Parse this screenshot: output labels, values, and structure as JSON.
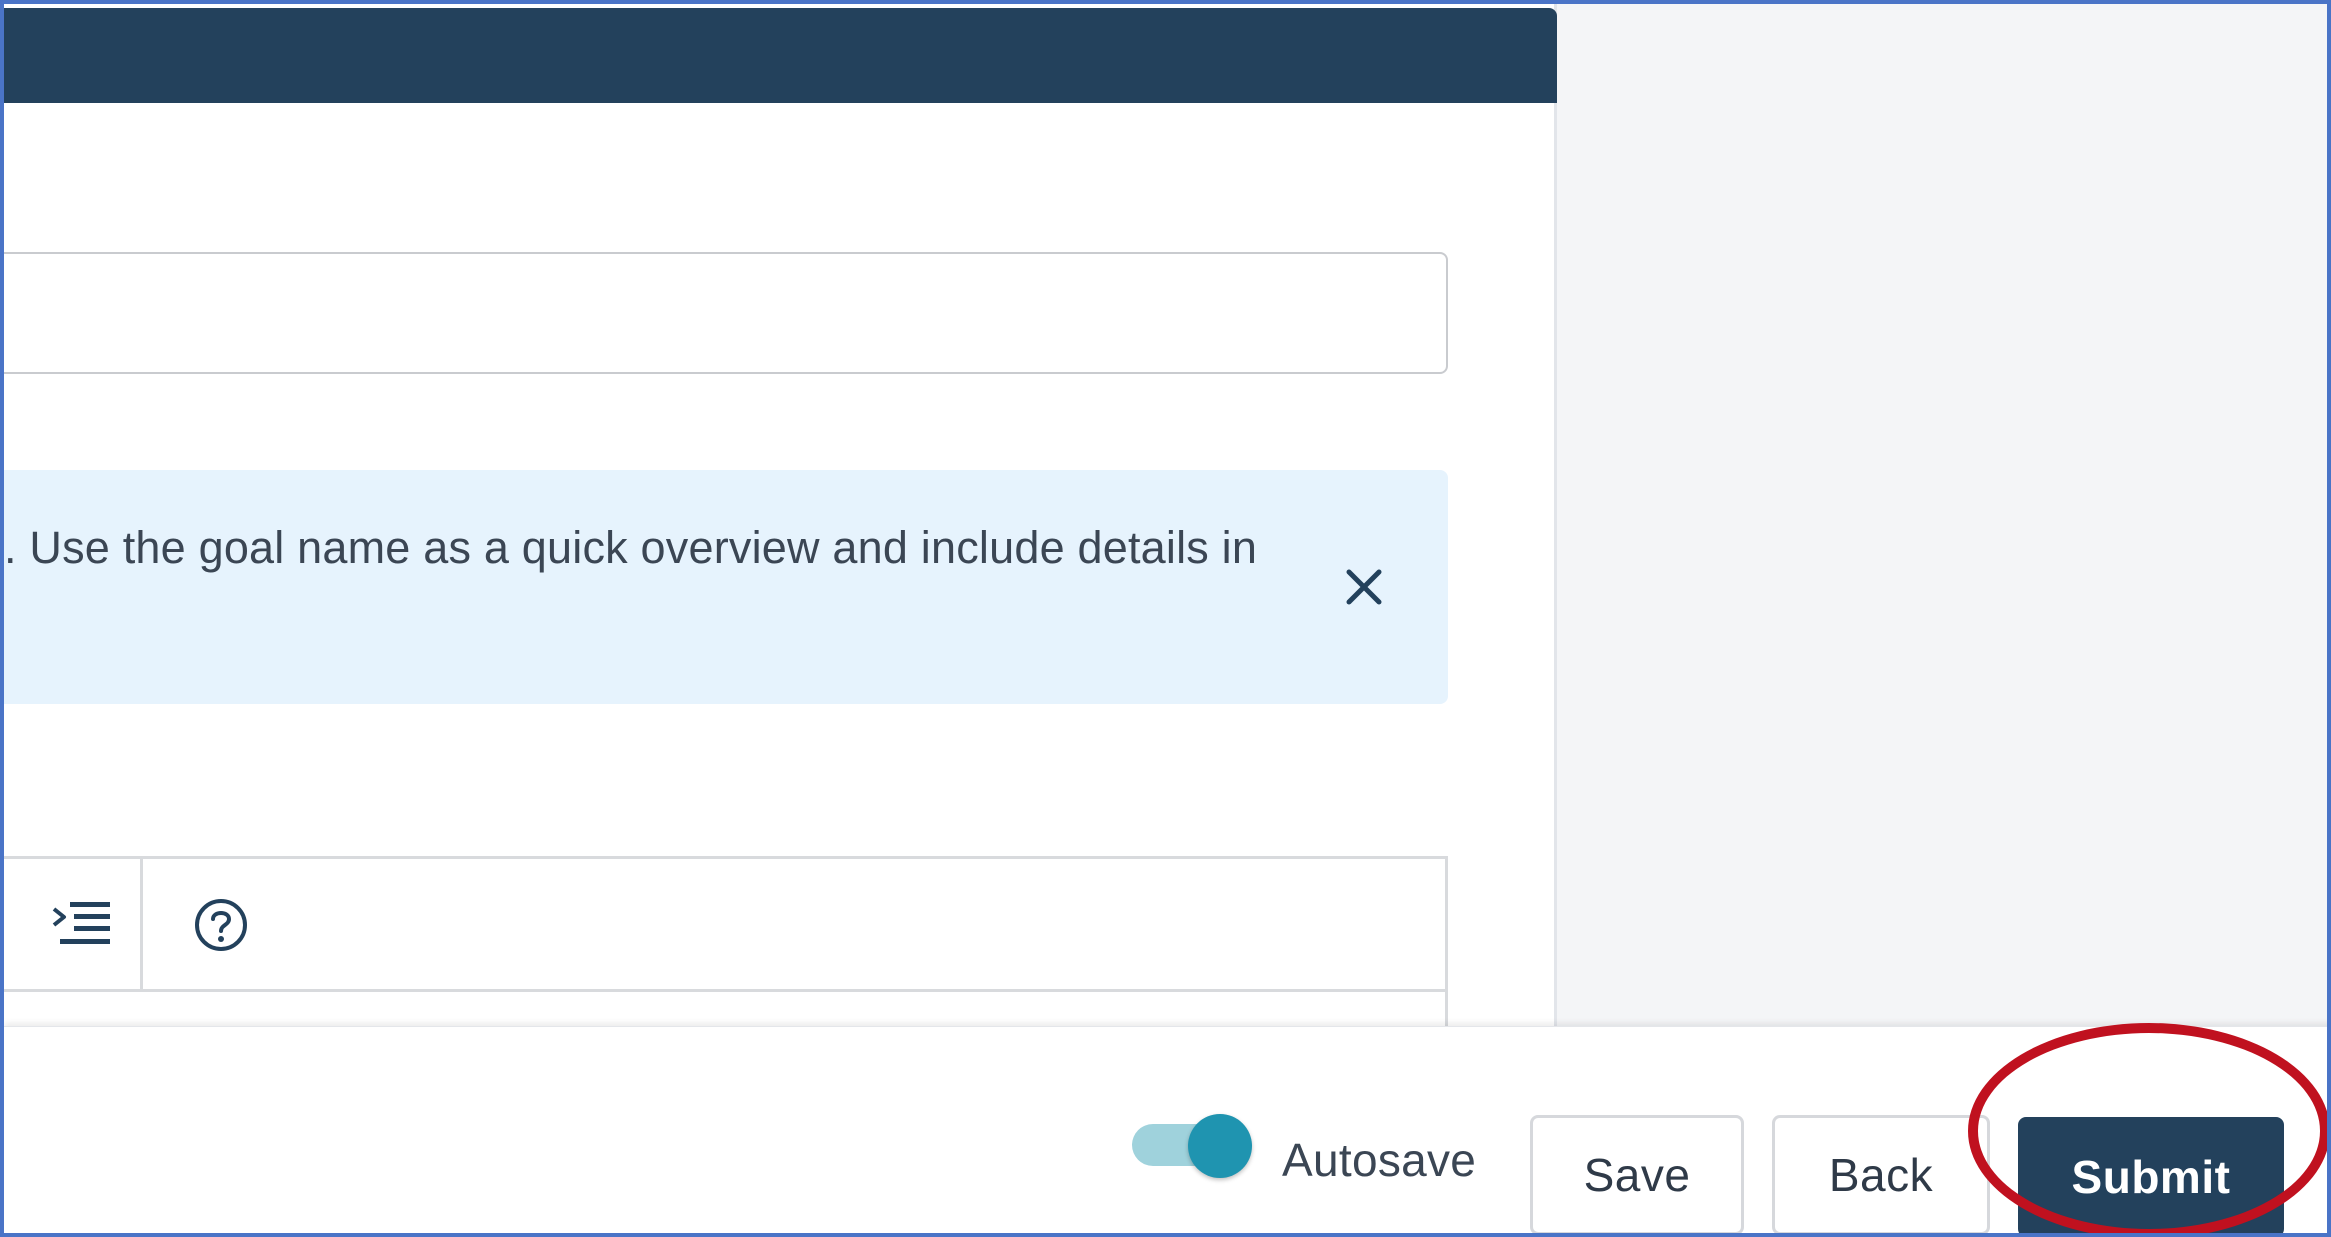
{
  "info_banner": {
    "text": ". Use the goal name as a quick overview and include details in"
  },
  "goal_name": {
    "value": "",
    "placeholder": ""
  },
  "editor": {
    "toolbar_icons": [
      "indent-icon",
      "help-circle-icon"
    ]
  },
  "footer": {
    "autosave_label": "Autosave",
    "autosave_enabled": true,
    "save_label": "Save",
    "back_label": "Back",
    "submit_label": "Submit"
  },
  "colors": {
    "header": "#23415c",
    "banner_bg": "#e6f3fd",
    "toggle_track": "#9fd2dc",
    "toggle_knob": "#1f94b0",
    "submit_bg": "#23415c",
    "highlight": "#c0111f",
    "frame_border": "#4a74c7"
  }
}
